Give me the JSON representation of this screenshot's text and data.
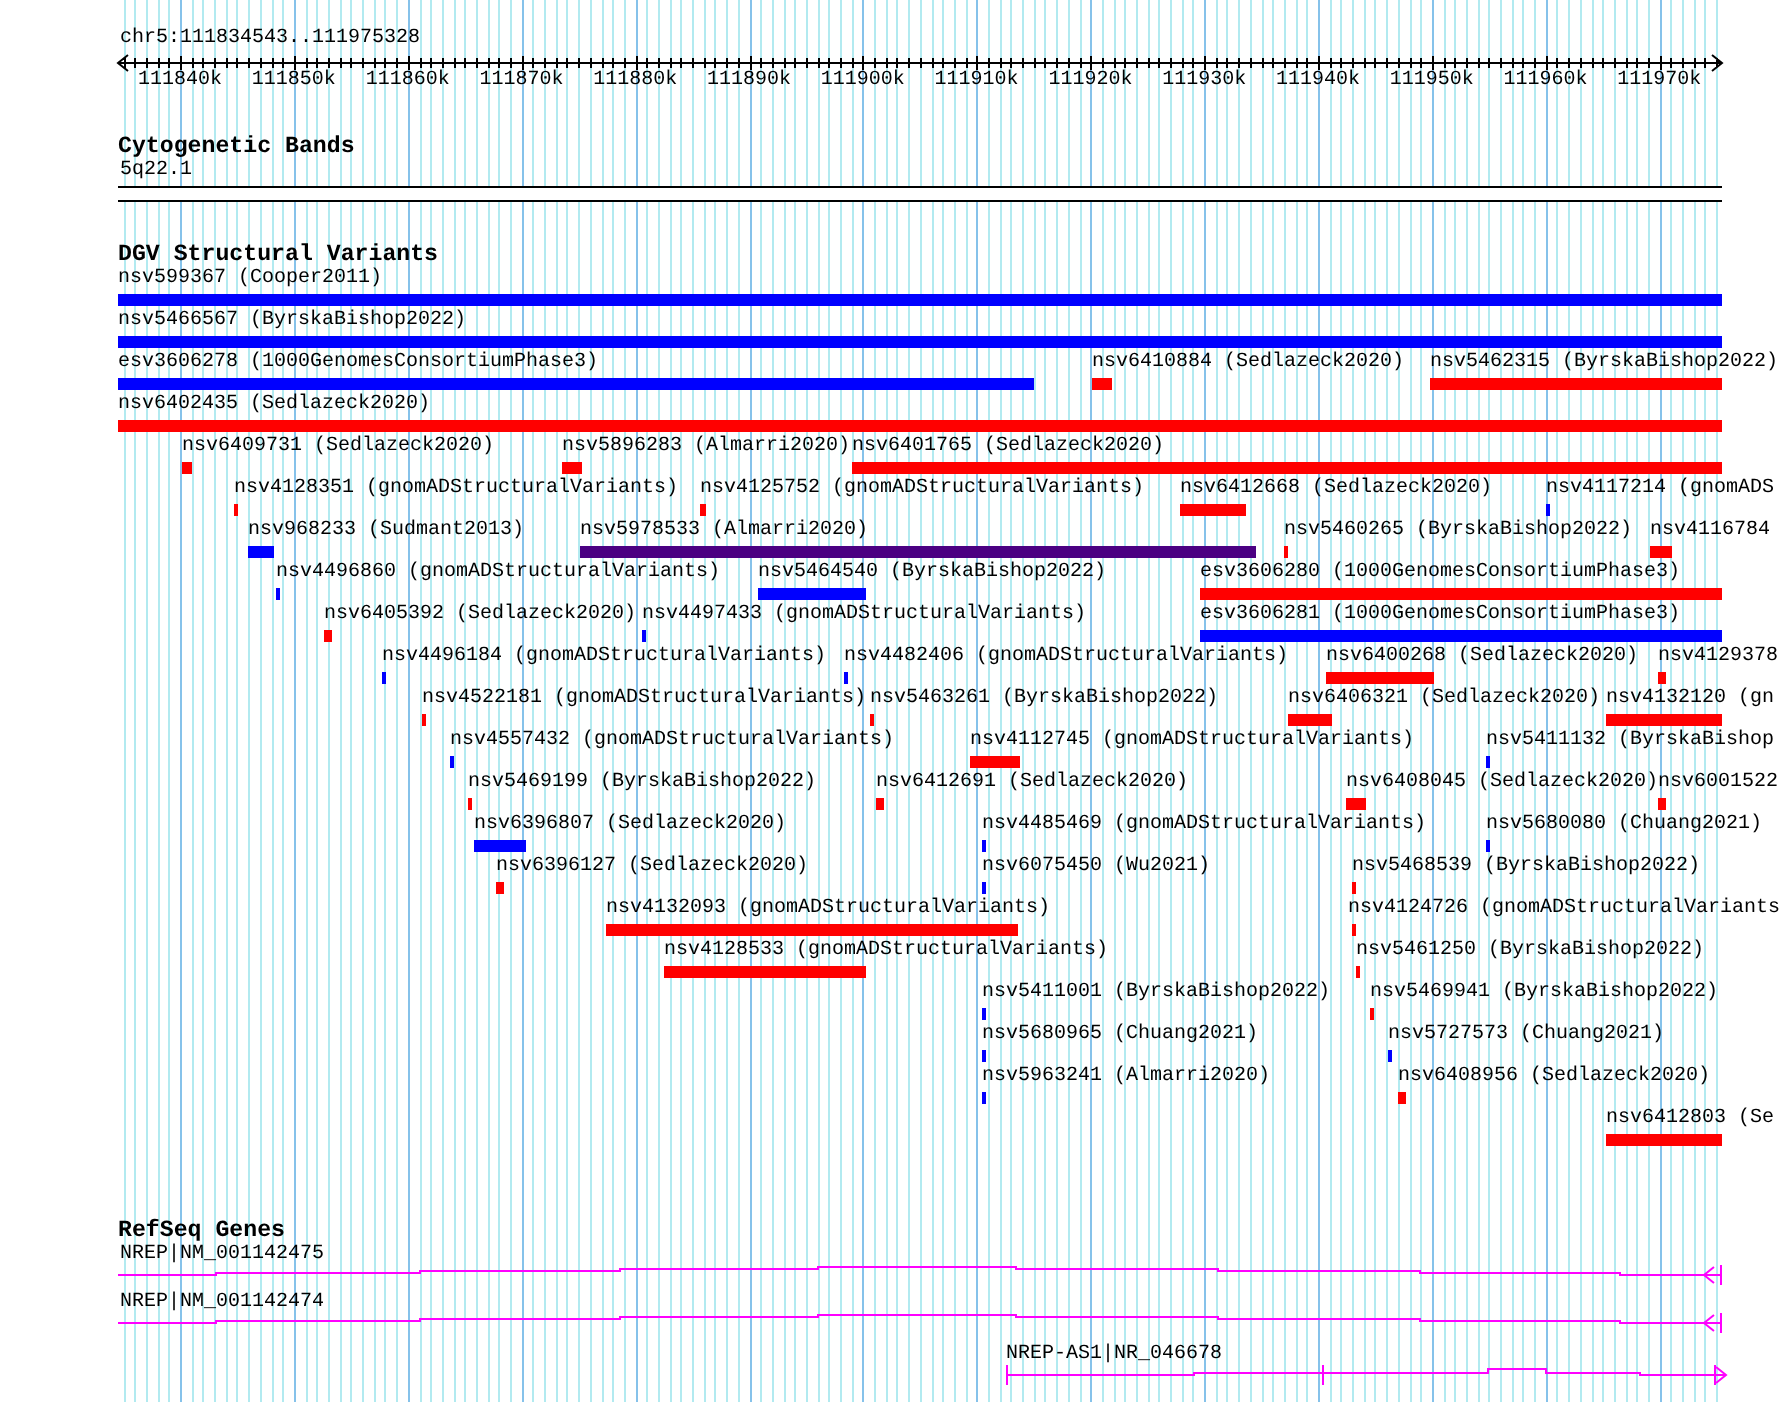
{
  "ruler": {
    "location": "chr5:111834543..111975328",
    "ticks": [
      "111840k",
      "111850k",
      "111860k",
      "111870k",
      "111880k",
      "111890k",
      "111900k",
      "111910k",
      "111920k",
      "111930k",
      "111940k",
      "111950k",
      "111960k",
      "111970k"
    ]
  },
  "cytogenetic_bands": {
    "title": "Cytogenetic Bands",
    "bands": [
      {
        "label": "5q22.1"
      }
    ]
  },
  "dgv_structural_variants": {
    "title": "DGV Structural Variants",
    "rows": [
      {
        "features": [
          {
            "label": "nsv599367 (Cooper2011)",
            "color": "#0000ff"
          }
        ]
      },
      {
        "features": [
          {
            "label": "nsv5466567 (ByrskaBishop2022)",
            "color": "#0000ff"
          }
        ]
      },
      {
        "features": [
          {
            "label": "esv3606278 (1000GenomesConsortiumPhase3)",
            "color": "#0000ff"
          },
          {
            "label": "nsv6410884 (Sedlazeck2020)",
            "color": "#ff0000"
          },
          {
            "label": "nsv5462315 (ByrskaBishop2022)",
            "color": "#ff0000"
          }
        ]
      },
      {
        "features": [
          {
            "label": "nsv6402435 (Sedlazeck2020)",
            "color": "#ff0000"
          }
        ]
      },
      {
        "features": [
          {
            "label": "nsv6409731 (Sedlazeck2020)",
            "color": "#ff0000"
          },
          {
            "label": "nsv5896283 (Almarri2020)",
            "color": "#ff0000"
          },
          {
            "label": "nsv6401765 (Sedlazeck2020)",
            "color": "#ff0000"
          }
        ]
      },
      {
        "features": [
          {
            "label": "nsv4128351 (gnomADStructuralVariants)",
            "color": "#ff0000"
          },
          {
            "label": "nsv4125752 (gnomADStructuralVariants)",
            "color": "#ff0000"
          },
          {
            "label": "nsv6412668 (Sedlazeck2020)",
            "color": "#ff0000"
          },
          {
            "label": "nsv4117214 (gnomADS",
            "color": "#0000ff"
          }
        ]
      },
      {
        "features": [
          {
            "label": "nsv968233 (Sudmant2013)",
            "color": "#0000ff"
          },
          {
            "label": "nsv5978533 (Almarri2020)",
            "color": "#4b0082"
          },
          {
            "label": "nsv5460265 (ByrskaBishop2022)",
            "color": "#ff0000"
          },
          {
            "label": "nsv4116784",
            "color": "#ff0000"
          }
        ]
      },
      {
        "features": [
          {
            "label": "nsv4496860 (gnomADStructuralVariants)",
            "color": "#0000ff"
          },
          {
            "label": "nsv5464540 (ByrskaBishop2022)",
            "color": "#0000ff"
          },
          {
            "label": "esv3606280 (1000GenomesConsortiumPhase3)",
            "color": "#ff0000"
          }
        ]
      },
      {
        "features": [
          {
            "label": "nsv6405392 (Sedlazeck2020)",
            "color": "#ff0000"
          },
          {
            "label": "nsv4497433 (gnomADStructuralVariants)",
            "color": "#0000ff"
          },
          {
            "label": "esv3606281 (1000GenomesConsortiumPhase3)",
            "color": "#0000ff"
          }
        ]
      },
      {
        "features": [
          {
            "label": "nsv4496184 (gnomADStructuralVariants)",
            "color": "#0000ff"
          },
          {
            "label": "nsv4482406 (gnomADStructuralVariants)",
            "color": "#0000ff"
          },
          {
            "label": "nsv6400268 (Sedlazeck2020)",
            "color": "#ff0000"
          },
          {
            "label": "nsv4129378",
            "color": "#ff0000"
          }
        ]
      },
      {
        "features": [
          {
            "label": "nsv4522181 (gnomADStructuralVariants)",
            "color": "#ff0000"
          },
          {
            "label": "nsv5463261 (ByrskaBishop2022)",
            "color": "#ff0000"
          },
          {
            "label": "nsv6406321 (Sedlazeck2020)",
            "color": "#ff0000"
          },
          {
            "label": "nsv4132120 (gn",
            "color": "#ff0000"
          }
        ]
      },
      {
        "features": [
          {
            "label": "nsv4557432 (gnomADStructuralVariants)",
            "color": "#0000ff"
          },
          {
            "label": "nsv4112745 (gnomADStructuralVariants)",
            "color": "#ff0000"
          },
          {
            "label": "nsv5411132 (ByrskaBishop",
            "color": "#0000ff"
          }
        ]
      },
      {
        "features": [
          {
            "label": "nsv5469199 (ByrskaBishop2022)",
            "color": "#ff0000"
          },
          {
            "label": "nsv6412691 (Sedlazeck2020)",
            "color": "#ff0000"
          },
          {
            "label": "nsv6408045 (Sedlazeck2020)",
            "color": "#ff0000"
          },
          {
            "label": "nsv6001522",
            "color": "#ff0000"
          }
        ]
      },
      {
        "features": [
          {
            "label": "nsv6396807 (Sedlazeck2020)",
            "color": "#0000ff"
          },
          {
            "label": "nsv4485469 (gnomADStructuralVariants)",
            "color": "#0000ff"
          },
          {
            "label": "nsv5680080 (Chuang2021)",
            "color": "#0000ff"
          }
        ]
      },
      {
        "features": [
          {
            "label": "nsv6396127 (Sedlazeck2020)",
            "color": "#ff0000"
          },
          {
            "label": "nsv6075450 (Wu2021)",
            "color": "#0000ff"
          },
          {
            "label": "nsv5468539 (ByrskaBishop2022)",
            "color": "#ff0000"
          }
        ]
      },
      {
        "features": [
          {
            "label": "nsv4132093 (gnomADStructuralVariants)",
            "color": "#ff0000"
          },
          {
            "label": "nsv4124726 (gnomADStructuralVariants",
            "color": "#ff0000"
          }
        ]
      },
      {
        "features": [
          {
            "label": "nsv4128533 (gnomADStructuralVariants)",
            "color": "#ff0000"
          },
          {
            "label": "nsv5461250 (ByrskaBishop2022)",
            "color": "#ff0000"
          }
        ]
      },
      {
        "features": [
          {
            "label": "nsv5411001 (ByrskaBishop2022)",
            "color": "#0000ff"
          },
          {
            "label": "nsv5469941 (ByrskaBishop2022)",
            "color": "#ff0000"
          }
        ]
      },
      {
        "features": [
          {
            "label": "nsv5680965 (Chuang2021)",
            "color": "#0000ff"
          },
          {
            "label": "nsv5727573 (Chuang2021)",
            "color": "#0000ff"
          }
        ]
      },
      {
        "features": [
          {
            "label": "nsv5963241 (Almarri2020)",
            "color": "#0000ff"
          },
          {
            "label": "nsv6408956 (Sedlazeck2020)",
            "color": "#ff0000"
          }
        ]
      },
      {
        "features": [
          {
            "label": "nsv6412803 (Se",
            "color": "#ff0000"
          }
        ]
      }
    ]
  },
  "refseq_genes": {
    "title": "RefSeq Genes",
    "genes": [
      {
        "label": "NREP|NM_001142475",
        "kind": "reverse"
      },
      {
        "label": "NREP|NM_001142474",
        "kind": "reverse"
      },
      {
        "label": "NREP-AS1|NR_046678",
        "kind": "forward"
      }
    ]
  }
}
